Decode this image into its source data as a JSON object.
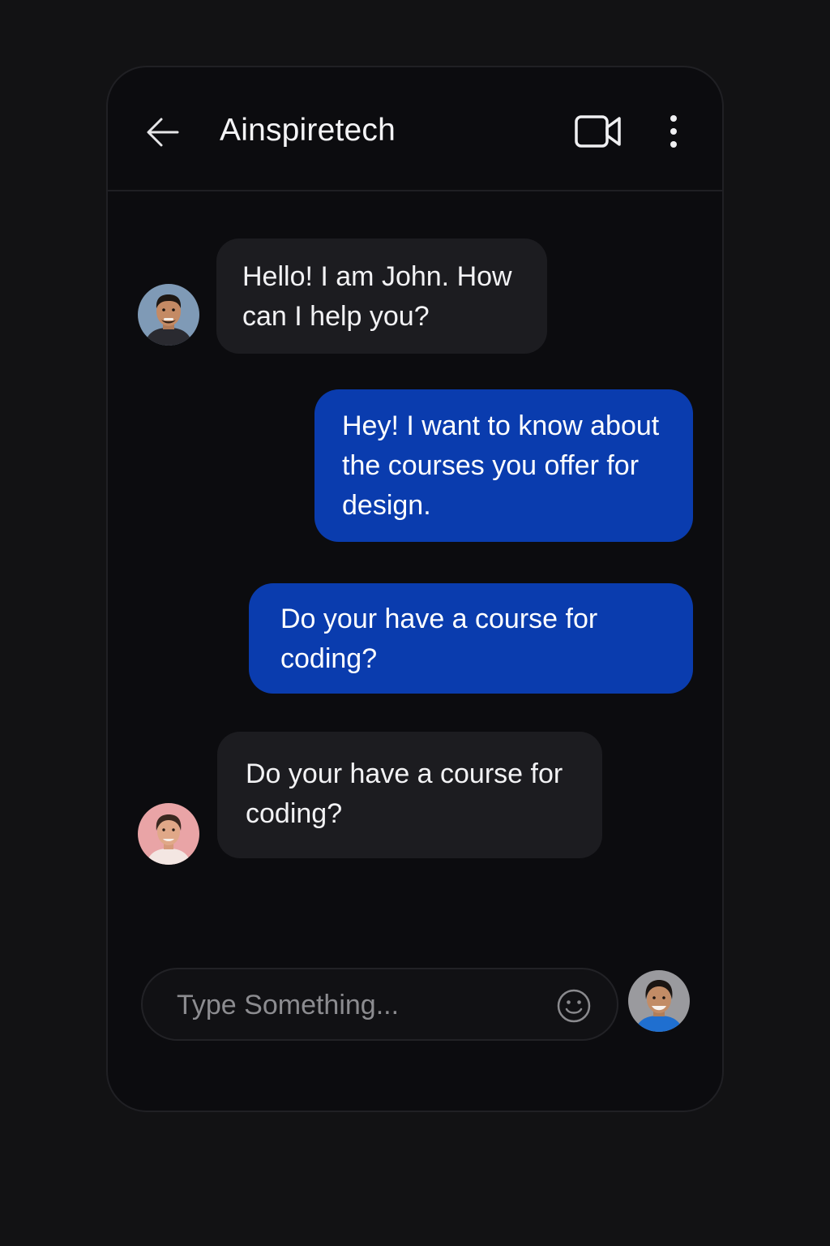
{
  "header": {
    "title": "Ainspiretech",
    "back_icon": "arrow-left-icon",
    "video_icon": "video-camera-icon",
    "more_icon": "more-vertical-icon"
  },
  "messages": [
    {
      "direction": "incoming",
      "avatar": "avatar-john",
      "text": "Hello! I am John. How can I help you?"
    },
    {
      "direction": "outgoing",
      "text": "Hey! I want to know about the courses you offer for design."
    },
    {
      "direction": "outgoing",
      "text": "Do your have a course for coding?"
    },
    {
      "direction": "incoming",
      "avatar": "avatar-agent",
      "text": "Do your have a course for coding?"
    }
  ],
  "composer": {
    "placeholder": "Type Something...",
    "emoji_icon": "smiley-icon",
    "user_avatar": "avatar-user"
  },
  "colors": {
    "page_background": "#121214",
    "panel_background": "#0c0c0f",
    "incoming_bubble": "#1c1c20",
    "outgoing_bubble": "#0a3cae",
    "text": "#f2f2f4",
    "placeholder": "#8c8c90"
  }
}
